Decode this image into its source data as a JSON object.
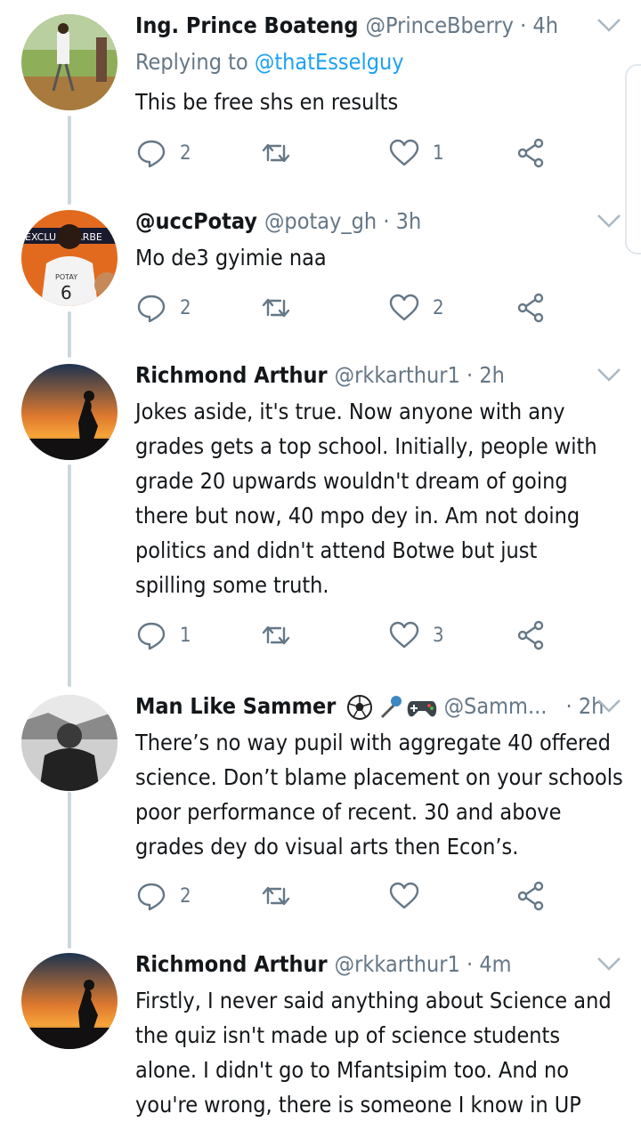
{
  "tweets": [
    {
      "name": "Ing. Prince Boateng",
      "handle": "@PrinceBberry",
      "sep": "·",
      "time": "4h",
      "replying_prefix": "Replying to",
      "replying_to": "@thatEsselguy",
      "text": "This be free shs en results",
      "replies": "2",
      "retweets": "",
      "likes": "1"
    },
    {
      "name": "@uccPotay",
      "handle": "@potay_gh",
      "sep": "·",
      "time": "3h",
      "text": "Mo de3 gyimie naa",
      "replies": "2",
      "retweets": "",
      "likes": "2"
    },
    {
      "name": "Richmond Arthur",
      "handle": "@rkkarthur1",
      "sep": "·",
      "time": "2h",
      "text_lines": [
        "Jokes aside, it's true. Now anyone with any",
        "grades gets a top school. Initially, people with",
        "grade 20 upwards wouldn't dream of going",
        "there but now, 40 mpo dey in. Am not doing",
        "politics and didn't attend Botwe but just",
        "spilling some truth."
      ],
      "replies": "1",
      "retweets": "",
      "likes": "3"
    },
    {
      "name": "Man Like Sammer",
      "handle": "@Samm...",
      "sep": "·",
      "time": "2h",
      "text_lines": [
        "There’s no way pupil with aggregate 40 offered",
        "science. Don’t blame placement on your schools",
        "poor performance of recent. 30 and above",
        "grades dey do visual arts then Econ’s."
      ],
      "replies": "2",
      "retweets": "",
      "likes": ""
    },
    {
      "name": "Richmond Arthur",
      "handle": "@rkkarthur1",
      "sep": "·",
      "time": "4m",
      "text_lines": [
        "Firstly, I never said anything about Science and",
        "the quiz isn't made up of science students",
        "alone. I didn't go to Mfantsipim too. And no",
        "you're wrong, there is someone I know in UP"
      ]
    }
  ],
  "icons": {
    "reply": "reply-icon",
    "retweet": "retweet-icon",
    "like": "heart-icon",
    "share": "share-icon",
    "more": "chevron-down-icon"
  },
  "colors": {
    "text": "#14171a",
    "muted": "#657786",
    "link": "#1da1f2",
    "thread_line": "#ccd6dd"
  }
}
